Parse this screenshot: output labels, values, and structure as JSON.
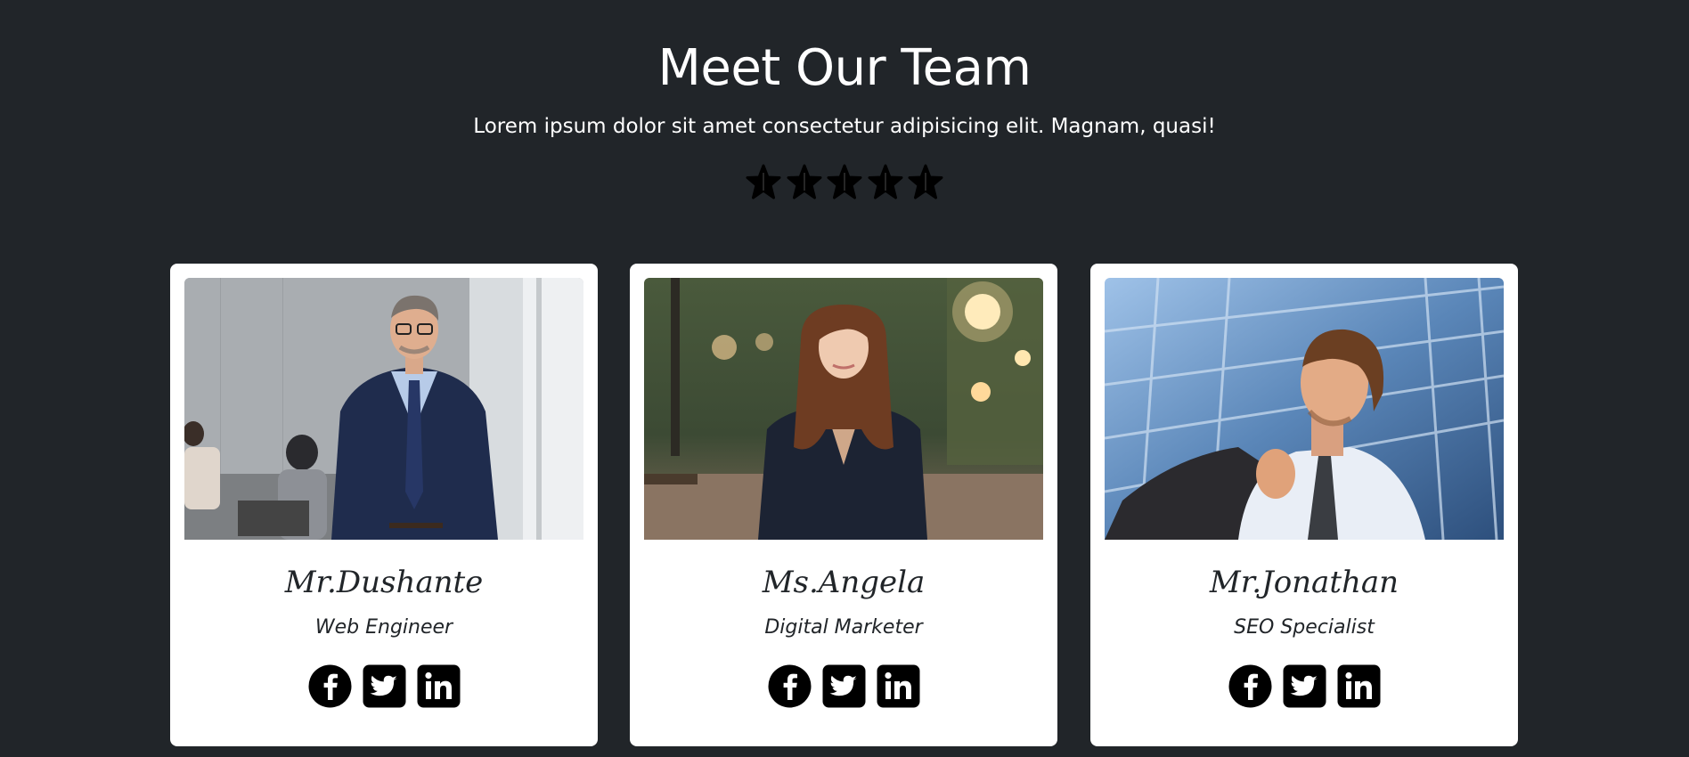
{
  "header": {
    "title": "Meet Our Team",
    "subtitle": "Lorem ipsum dolor sit amet consectetur adipisicing elit. Magnam, quasi!"
  },
  "rating": {
    "stars": 5,
    "icon": "star-icon",
    "color": "#000000"
  },
  "colors": {
    "background": "#212529",
    "card": "#ffffff",
    "text_dark": "#212529"
  },
  "team": [
    {
      "name": "Mr.Dushante",
      "role": "Web Engineer",
      "photo": "man-in-navy-suit-office-photo",
      "socials": [
        "facebook-icon",
        "twitter-icon",
        "linkedin-icon"
      ]
    },
    {
      "name": "Ms.Angela",
      "role": "Digital Marketer",
      "photo": "woman-in-blazer-street-photo",
      "socials": [
        "facebook-icon",
        "twitter-icon",
        "linkedin-icon"
      ]
    },
    {
      "name": "Mr.Jonathan",
      "role": "SEO Specialist",
      "photo": "man-with-jacket-over-shoulder-photo",
      "socials": [
        "facebook-icon",
        "twitter-icon",
        "linkedin-icon"
      ]
    }
  ]
}
